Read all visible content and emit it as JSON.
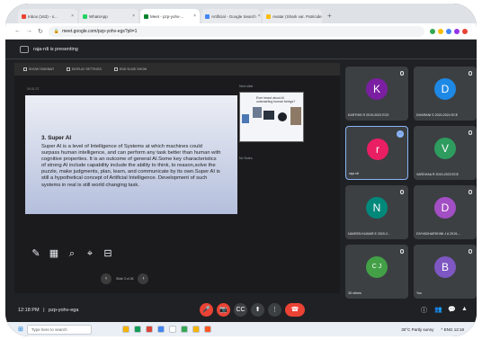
{
  "browser": {
    "tabs": [
      {
        "label": "Inbox (163) - s...",
        "color": "#ea4335",
        "active": false
      },
      {
        "label": "WhatsApp",
        "color": "#25d366",
        "active": false
      },
      {
        "label": "Meet - pzp-yohv-...",
        "color": "#00832d",
        "active": true
      },
      {
        "label": "Artificial - Google Search",
        "color": "#4285f4",
        "active": false
      },
      {
        "label": "Avatar (Shark var. Patricide)",
        "color": "#fbbc04",
        "active": false
      }
    ],
    "url": "meet.google.com/pzp-yohv-egs?pli=1",
    "extension_colors": [
      "#34a853",
      "#fbbc04",
      "#4285f4",
      "#9334e6",
      "#ea4335"
    ]
  },
  "presenting_banner": "raja-rdi is presenting",
  "ppt": {
    "toolbar": [
      "SHOW TASKBAR",
      "DISPLAY SETTINGS",
      "END SLIDE SHOW"
    ],
    "timer": "00:01:27",
    "next_slide_label": "Next slide",
    "slide": {
      "title": "3. Super AI",
      "body": "Super AI is a level of Intelligence of Systems at which machines could surpass human intelligence, and can perform any task better than human with cognitive properties. It is an outcome of general AI.Some key characteristics of strong AI include capability include the ability to think, to reason,solve the puzzle, make judgments, plan, learn, and communicate by its own.Super AI is still a hypothetical concept of Artificial Intelligence. Development of such systems in real is still world changing task."
    },
    "next_slide_text": "Ever heard about AI outsmarting human beings?",
    "notes_label": "No Notes",
    "slide_position": "Slide 3 of 26",
    "tools": [
      "pen-icon",
      "slides-grid-icon",
      "zoom-icon",
      "pointer-icon",
      "subtitles-icon"
    ],
    "nav": {
      "prev": "‹",
      "next": "›"
    }
  },
  "participants": [
    {
      "initial": "K",
      "name": "KARTHIK R 2019-2023 ECE",
      "color": "#7b1fa2",
      "selected": false
    },
    {
      "initial": "D",
      "name": "DHARANI S 2020-2024 ECE",
      "color": "#1e88e5",
      "selected": false
    },
    {
      "initial": "r",
      "name": "raja rdi",
      "color": "#e91e63",
      "selected": true
    },
    {
      "initial": "V",
      "name": "VARDHAA R 2019-2023 ECE",
      "color": "#2e9c5f",
      "selected": false
    },
    {
      "initial": "N",
      "name": "NAVEEN KUMAR E 2020-2...",
      "color": "#00897b",
      "selected": false
    },
    {
      "initial": "D",
      "name": "DIVYADHARSHINI J A 2019-...",
      "color": "#a24ec4",
      "selected": false
    },
    {
      "initial": "C J",
      "name": "35 others",
      "color": "#43a047",
      "selected": false
    },
    {
      "initial": "B",
      "name": "You",
      "color": "#7e57c2",
      "selected": false
    }
  ],
  "more_options_glyph": "⋯",
  "meeting": {
    "time": "12:18 PM",
    "separator": "|",
    "code": "pzp-yohv-ega"
  },
  "controls": [
    {
      "name": "mic-off-button",
      "glyph": "🎤",
      "color": "#ea4335"
    },
    {
      "name": "camera-off-button",
      "glyph": "📷",
      "color": "#ea4335"
    },
    {
      "name": "captions-button",
      "glyph": "CC",
      "color": "#3c4043"
    },
    {
      "name": "present-button",
      "glyph": "⬆",
      "color": "#3c4043"
    },
    {
      "name": "more-options-button",
      "glyph": "⋮",
      "color": "#3c4043"
    },
    {
      "name": "leave-call-button",
      "glyph": "☎",
      "color": "#ea4335"
    }
  ],
  "right_controls": [
    {
      "name": "info-icon",
      "glyph": "ⓘ"
    },
    {
      "name": "people-icon",
      "glyph": "👥"
    },
    {
      "name": "chat-icon",
      "glyph": "💬"
    },
    {
      "name": "activities-icon",
      "glyph": "▲"
    }
  ],
  "taskbar": {
    "search_placeholder": "Type here to search",
    "app_colors": [
      "#f4b400",
      "#0f9d58",
      "#db4437",
      "#4285f4",
      "#ffffff",
      "#34a853",
      "#f4b400",
      "#ff5722"
    ],
    "weather": "30°C  Partly sunny",
    "tray": "^ ENG 12:18"
  }
}
